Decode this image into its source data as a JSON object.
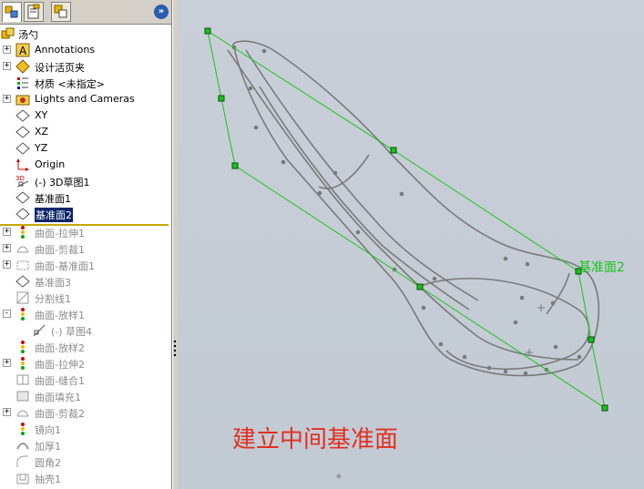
{
  "tree": {
    "root_label": "汤勺",
    "expand_button": "»",
    "items": [
      {
        "label": "Annotations",
        "icon": "annotations-icon",
        "pm": "+"
      },
      {
        "label": "设计活页夹",
        "icon": "design-binder-icon",
        "pm": "+"
      },
      {
        "label": "材质 <未指定>",
        "icon": "material-icon",
        "pm": ""
      },
      {
        "label": "Lights and Cameras",
        "icon": "lights-cameras-icon",
        "pm": "+"
      },
      {
        "label": "XY",
        "icon": "plane-icon",
        "pm": ""
      },
      {
        "label": "XZ",
        "icon": "plane-icon",
        "pm": ""
      },
      {
        "label": "YZ",
        "icon": "plane-icon",
        "pm": ""
      },
      {
        "label": "Origin",
        "icon": "origin-icon",
        "pm": ""
      },
      {
        "label": "(-) 3D草图1",
        "icon": "3d-sketch-icon",
        "pm": ""
      },
      {
        "label": "基准面1",
        "icon": "plane-icon",
        "pm": ""
      },
      {
        "label": "基准面2",
        "icon": "plane-icon",
        "pm": "",
        "selected": true
      }
    ],
    "suppressed_items": [
      {
        "label": "曲面-拉伸1",
        "icon": "extrude-surface-icon",
        "pm": "+"
      },
      {
        "label": "曲面-剪裁1",
        "icon": "trim-surface-icon",
        "pm": "+"
      },
      {
        "label": "曲面-基准面1",
        "icon": "planar-surface-icon",
        "pm": "+"
      },
      {
        "label": "基准面3",
        "icon": "plane-icon",
        "pm": ""
      },
      {
        "label": "分割线1",
        "icon": "split-line-icon",
        "pm": ""
      },
      {
        "label": "曲面-放样1",
        "icon": "loft-surface-icon",
        "pm": "-"
      },
      {
        "label": "(-) 草图4",
        "icon": "sketch-icon",
        "pm": "",
        "indent": true
      },
      {
        "label": "曲面-放样2",
        "icon": "loft-surface-icon",
        "pm": ""
      },
      {
        "label": "曲面-拉伸2",
        "icon": "extrude-surface-icon",
        "pm": "+"
      },
      {
        "label": "曲面-缝合1",
        "icon": "knit-surface-icon",
        "pm": ""
      },
      {
        "label": "曲面填充1",
        "icon": "fill-surface-icon",
        "pm": ""
      },
      {
        "label": "曲面-剪裁2",
        "icon": "trim-surface-icon",
        "pm": "+"
      },
      {
        "label": "镜向1",
        "icon": "mirror-icon",
        "pm": ""
      },
      {
        "label": "加厚1",
        "icon": "thicken-icon",
        "pm": ""
      },
      {
        "label": "圆角2",
        "icon": "fillet-icon",
        "pm": ""
      },
      {
        "label": "抽壳1",
        "icon": "shell-icon",
        "pm": ""
      }
    ]
  },
  "viewport": {
    "plane_label": "基准面2",
    "caption": "建立中间基准面",
    "plane_color": "#19c319",
    "curve_color": "#7a7a7a",
    "caption_color": "#e0301e"
  }
}
